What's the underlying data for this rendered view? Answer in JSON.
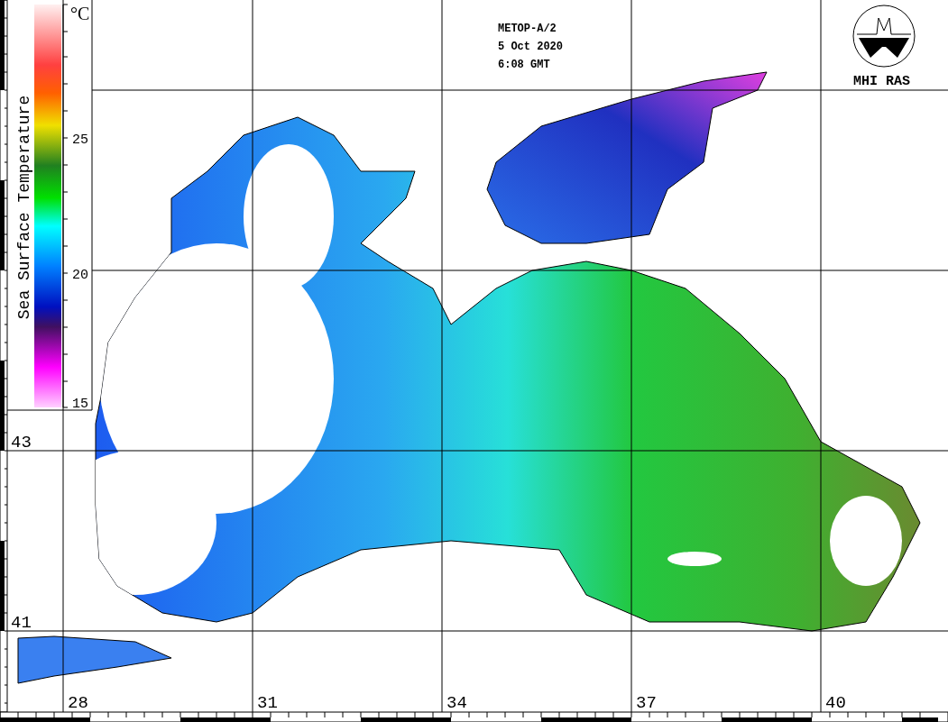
{
  "header": {
    "satellite": "METOP-A/2",
    "date": "5 Oct 2020",
    "time": "6:08 GMT"
  },
  "logo": {
    "text": "MHI RAS"
  },
  "legend": {
    "title": "Sea Surface Temperature",
    "unit": "°C",
    "ticks": [
      "25",
      "20",
      "15"
    ]
  },
  "latitude_labels": [
    "43",
    "41"
  ],
  "longitude_labels": [
    "28",
    "31",
    "34",
    "37",
    "40"
  ]
}
